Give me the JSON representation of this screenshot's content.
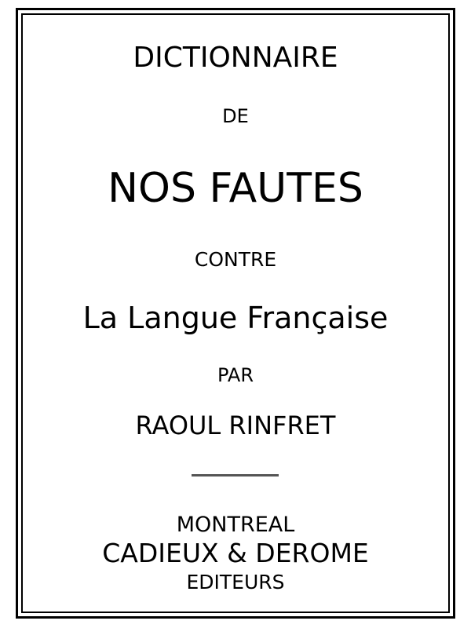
{
  "title_page": {
    "line1": "DICTIONNAIRE",
    "line2": "DE",
    "line3": "NOS FAUTES",
    "line4": "CONTRE",
    "line5": "La Langue Française",
    "line6": "PAR",
    "author": "RAOUL RINFRET",
    "city": "MONTREAL",
    "publisher": "CADIEUX & DEROME",
    "publisher_role": "EDITEURS"
  },
  "colors": {
    "text": "#000000",
    "border": "#000000",
    "rule": "#555555",
    "background": "#ffffff"
  }
}
